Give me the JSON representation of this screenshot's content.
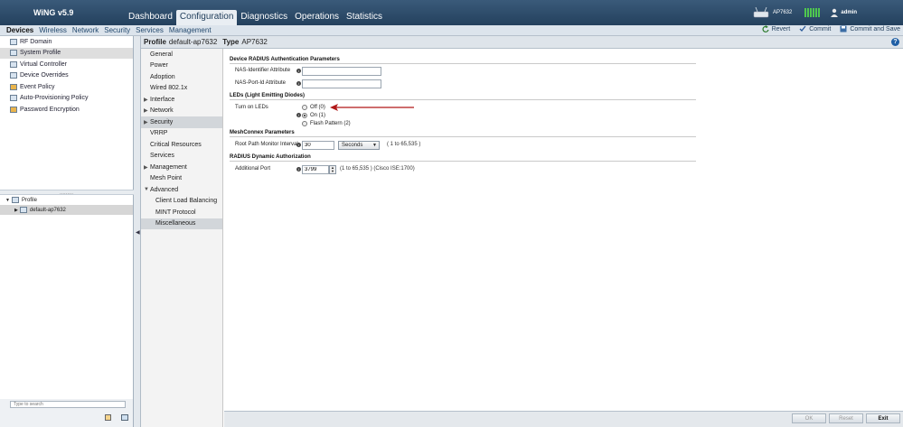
{
  "app": {
    "title": "WiNG v5.9"
  },
  "nav": {
    "tabs": [
      {
        "label": "Dashboard"
      },
      {
        "label": "Configuration"
      },
      {
        "label": "Diagnostics"
      },
      {
        "label": "Operations"
      },
      {
        "label": "Statistics"
      }
    ],
    "active": "Configuration"
  },
  "header_right": {
    "device_name": "AP7632",
    "user": "admin"
  },
  "subnav": {
    "tabs": [
      {
        "label": "Devices"
      },
      {
        "label": "Wireless"
      },
      {
        "label": "Network"
      },
      {
        "label": "Security"
      },
      {
        "label": "Services"
      },
      {
        "label": "Management"
      }
    ],
    "active": "Devices"
  },
  "actions": {
    "revert": "Revert",
    "commit": "Commit",
    "commit_save": "Commit and Save"
  },
  "left_tree": {
    "items": [
      {
        "label": "RF Domain"
      },
      {
        "label": "System Profile"
      },
      {
        "label": "Virtual Controller"
      },
      {
        "label": "Device Overrides"
      },
      {
        "label": "Event Policy"
      },
      {
        "label": "Auto-Provisioning Policy"
      },
      {
        "label": "Password Encryption"
      }
    ],
    "selected": "System Profile"
  },
  "bottom_tree": {
    "root": "Profile",
    "child": "default-ap7632"
  },
  "search": {
    "placeholder": "Type to search"
  },
  "profile_header": {
    "profile_label": "Profile",
    "profile_value": "default-ap7632",
    "type_label": "Type",
    "type_value": "AP7632"
  },
  "side_menu": {
    "items": [
      {
        "label": "General"
      },
      {
        "label": "Power"
      },
      {
        "label": "Adoption"
      },
      {
        "label": "Wired 802.1x"
      },
      {
        "label": "Interface"
      },
      {
        "label": "Network"
      },
      {
        "label": "Security"
      },
      {
        "label": "VRRP"
      },
      {
        "label": "Critical Resources"
      },
      {
        "label": "Services"
      },
      {
        "label": "Management"
      },
      {
        "label": "Mesh Point"
      },
      {
        "label": "Advanced"
      },
      {
        "label": "Client Load Balancing"
      },
      {
        "label": "MINT Protocol"
      },
      {
        "label": "Miscellaneous"
      }
    ],
    "selected": "Miscellaneous"
  },
  "form": {
    "radius_section": "Device RADIUS Authentication Parameters",
    "nas_identifier_label": "NAS-Identifier Attribute",
    "nas_identifier_value": "",
    "nas_portid_label": "NAS-Port-Id Attribute",
    "nas_portid_value": "",
    "leds_section": "LEDs (Light Emitting Diodes)",
    "turn_on_leds_label": "Turn on LEDs",
    "led_options": [
      {
        "label": "Off (0)",
        "checked": false
      },
      {
        "label": "On (1)",
        "checked": true
      },
      {
        "label": "Flash Pattern (2)",
        "checked": false
      }
    ],
    "mesh_section": "MeshConnex Parameters",
    "root_path_label": "Root Path Monitor Interval",
    "root_path_value": "30",
    "root_path_unit": "Seconds",
    "root_path_range": "( 1 to 65,535 )",
    "radius_dyn_section": "RADIUS Dynamic Authorization",
    "additional_port_label": "Additional Port",
    "additional_port_value": "3799",
    "additional_port_hint": "(1 to 65,535 )  (Cisco ISE:1700)"
  },
  "bottom_buttons": {
    "ok": "OK",
    "reset": "Reset",
    "exit": "Exit"
  },
  "colors": {
    "header": "#2e4e6e",
    "arrow_annotation": "#b01818",
    "signal": "#4fc74f"
  }
}
